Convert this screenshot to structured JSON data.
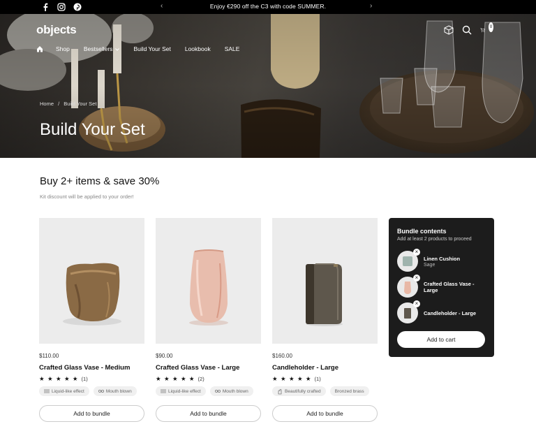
{
  "announcement": {
    "message": "Enjoy €290 off the C3 with code SUMMER."
  },
  "header": {
    "logo": "objects",
    "nav": [
      "Shop",
      "Bestsellers",
      "Build Your Set",
      "Lookbook",
      "SALE"
    ],
    "cart_count": "0"
  },
  "breadcrumb": {
    "home": "Home",
    "separator": "/",
    "current": "Build Your Set"
  },
  "hero": {
    "title": "Build Your Set"
  },
  "section": {
    "title": "Buy 2+ items & save 30%",
    "subtitle": "Kit discount will be applied to your order!"
  },
  "products": [
    {
      "price": "$110.00",
      "name": "Crafted Glass Vase - Medium",
      "stars": "★ ★ ★ ★ ★",
      "rating": 5,
      "reviews": "(1)",
      "tags": [
        "Liquid-like effect",
        "Mouth blown"
      ],
      "button": "Add to bundle"
    },
    {
      "price": "$90.00",
      "name": "Crafted Glass Vase - Large",
      "stars": "★ ★ ★ ★ ★",
      "rating": 4.5,
      "reviews": "(2)",
      "tags": [
        "Liquid-like effect",
        "Mouth blown"
      ],
      "button": "Add to bundle"
    },
    {
      "price": "$160.00",
      "name": "Candleholder - Large",
      "stars": "★ ★ ★ ★ ★",
      "rating": 5,
      "reviews": "(1)",
      "tags": [
        "Beautifully crafted",
        "Bronzed brass"
      ],
      "button": "Add to bundle"
    }
  ],
  "bundle": {
    "title": "Bundle contents",
    "subtitle": "Add at least 2 products to proceed",
    "items": [
      {
        "name": "Linen Cushion",
        "variant": "Sage"
      },
      {
        "name": "Crafted Glass Vase - Large",
        "variant": ""
      },
      {
        "name": "Candleholder - Large",
        "variant": ""
      }
    ],
    "button": "Add to cart"
  },
  "colors": {
    "topbar": "#000000",
    "bundle_bg": "#1c1c1c",
    "card_bg": "#ececec"
  }
}
